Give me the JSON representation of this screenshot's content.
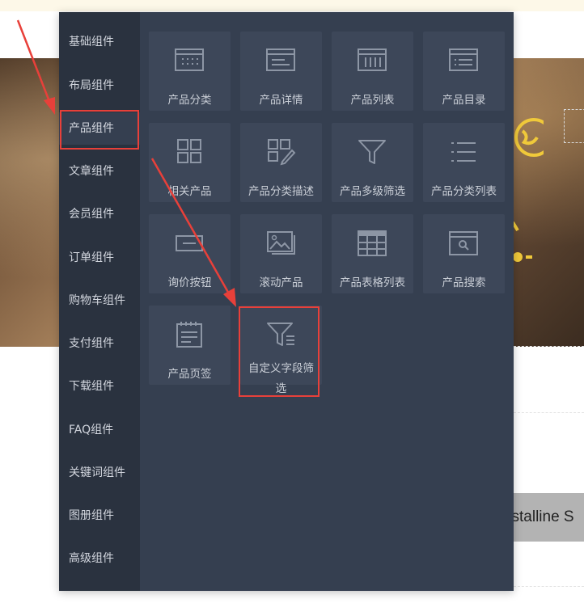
{
  "sidebar": {
    "items": [
      {
        "label": "基础组件"
      },
      {
        "label": "布局组件"
      },
      {
        "label": "产品组件"
      },
      {
        "label": "文章组件"
      },
      {
        "label": "会员组件"
      },
      {
        "label": "订单组件"
      },
      {
        "label": "购物车组件"
      },
      {
        "label": "支付组件"
      },
      {
        "label": "下载组件"
      },
      {
        "label": "FAQ组件"
      },
      {
        "label": "关键词组件"
      },
      {
        "label": "图册组件"
      },
      {
        "label": "高级组件"
      }
    ],
    "active_index": 2
  },
  "components": [
    {
      "label": "产品分类",
      "icon": "category-panel-icon"
    },
    {
      "label": "产品详情",
      "icon": "detail-panel-icon"
    },
    {
      "label": "产品列表",
      "icon": "list-columns-icon"
    },
    {
      "label": "产品目录",
      "icon": "catalog-icon"
    },
    {
      "label": "相关产品",
      "icon": "grid-squares-icon"
    },
    {
      "label": "产品分类描述",
      "icon": "grid-edit-icon"
    },
    {
      "label": "产品多级筛选",
      "icon": "filter-icon"
    },
    {
      "label": "产品分类列表",
      "icon": "bullet-list-icon"
    },
    {
      "label": "询价按钮",
      "icon": "button-icon"
    },
    {
      "label": "滚动产品",
      "icon": "image-gallery-icon"
    },
    {
      "label": "产品表格列表",
      "icon": "table-icon"
    },
    {
      "label": "产品搜索",
      "icon": "search-window-icon"
    },
    {
      "label": "产品页签",
      "icon": "notepad-icon"
    },
    {
      "label": "自定义字段筛选",
      "icon": "custom-filter-icon"
    }
  ],
  "background": {
    "banner_text": "ystalline S"
  },
  "colors": {
    "panel": "#353f50",
    "sidebar": "#2a323f",
    "tile": "#3d4759",
    "highlight": "#e8403a"
  }
}
